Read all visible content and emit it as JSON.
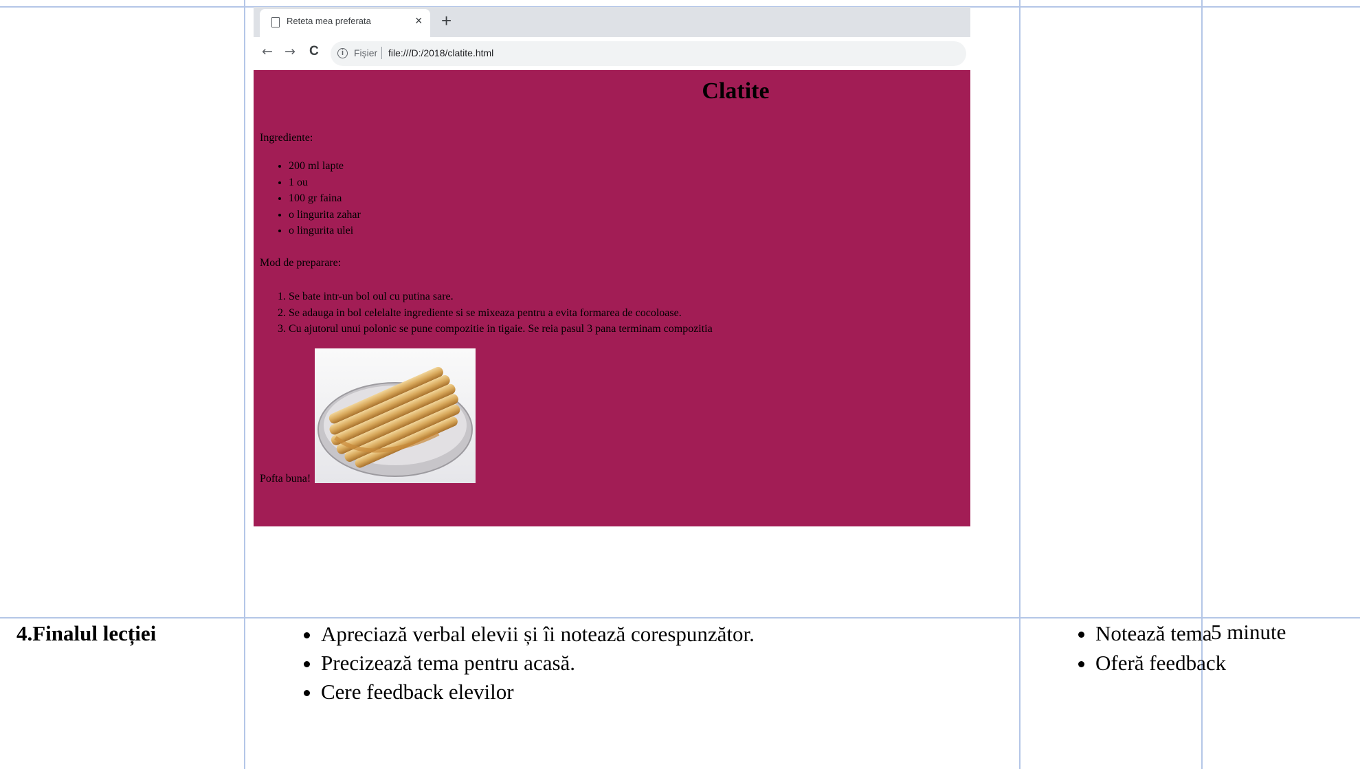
{
  "browser": {
    "tab_title": "Reteta mea preferata",
    "tab_close": "×",
    "new_tab": "+",
    "nav": {
      "back": "←",
      "forward": "→",
      "reload": "C"
    },
    "info_glyph": "i",
    "address_scheme_label": "Fișier",
    "address_url": "file:///D:/2018/clatite.html"
  },
  "recipe": {
    "title": "Clatite",
    "ingredients_label": "Ingrediente:",
    "ingredients": [
      "200 ml lapte",
      "1 ou",
      "100 gr faina",
      "o lingurita zahar",
      "o lingurita ulei"
    ],
    "method_label": "Mod de preparare:",
    "steps": [
      "Se bate intr-un bol oul cu putina sare.",
      "Se adauga in bol celelalte ingrediente si se mixeaza pentru a evita formarea de cocoloase.",
      "Cu ajutorul unui polonic se pune compozitie in tigaie. Se reia pasul 3 pana terminam compozitia"
    ],
    "closing": "Pofta buna!",
    "page_background": "#a21d55"
  },
  "table": {
    "stage_label": "4.Finalul lecției",
    "teacher_activities": [
      "Apreciază verbal elevii și îi notează corespunzător.",
      "Precizează tema pentru acasă.",
      "Cere feedback elevilor"
    ],
    "student_activities": [
      "Notează tema",
      "Oferă feedback"
    ],
    "duration": "5 minute",
    "border_color": "#b4c6e7"
  }
}
